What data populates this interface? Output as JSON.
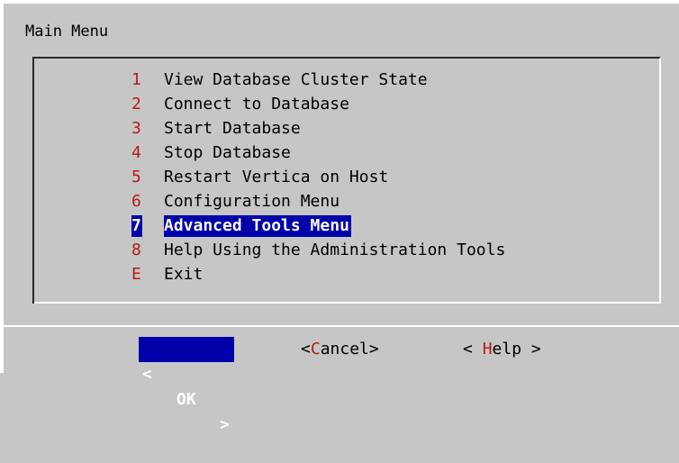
{
  "dialog": {
    "title": "Main Menu"
  },
  "menu": {
    "items": [
      {
        "key": "1",
        "label": "View Database Cluster State",
        "selected": false
      },
      {
        "key": "2",
        "label": "Connect to Database",
        "selected": false
      },
      {
        "key": "3",
        "label": "Start Database",
        "selected": false
      },
      {
        "key": "4",
        "label": "Stop Database",
        "selected": false
      },
      {
        "key": "5",
        "label": "Restart Vertica on Host",
        "selected": false
      },
      {
        "key": "6",
        "label": "Configuration Menu",
        "selected": false
      },
      {
        "key": "7",
        "label": "Advanced Tools Menu",
        "selected": true
      },
      {
        "key": "8",
        "label": "Help Using the Administration Tools",
        "selected": false
      },
      {
        "key": "E",
        "label": "Exit",
        "selected": false
      }
    ]
  },
  "buttons": {
    "ok": {
      "open": "<",
      "label": "OK",
      "close": ">"
    },
    "cancel": {
      "open": "<",
      "hotkey": "C",
      "rest": "ancel",
      "close": ">"
    },
    "help": {
      "open": "< ",
      "hotkey": "H",
      "rest": "elp",
      "close": " >"
    }
  },
  "colors": {
    "background": "#c6c6c6",
    "selection": "#0000aa",
    "hotkey": "#b31b1b",
    "text": "#000000",
    "highlight_text": "#ffffff"
  }
}
